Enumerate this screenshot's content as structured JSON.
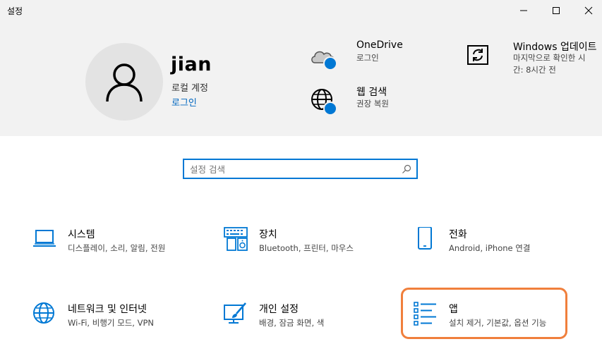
{
  "window": {
    "title": "설정"
  },
  "account": {
    "name": "jian",
    "type": "로컬 계정",
    "signin_label": "로그인"
  },
  "header_items": [
    {
      "title": "OneDrive",
      "sub": "로그인"
    },
    {
      "title": "웹 검색",
      "sub": "권장 복원"
    },
    {
      "title": "Windows 업데이트",
      "sub1": "마지막으로 확인한 시",
      "sub2": "간: 8시간 전"
    }
  ],
  "search": {
    "placeholder": "설정 검색"
  },
  "tiles": [
    {
      "title": "시스템",
      "sub": "디스플레이, 소리, 알림, 전원"
    },
    {
      "title": "장치",
      "sub": "Bluetooth, 프린터, 마우스"
    },
    {
      "title": "전화",
      "sub": "Android, iPhone 연결"
    },
    {
      "title": "네트워크 및 인터넷",
      "sub": "Wi-Fi, 비행기 모드, VPN"
    },
    {
      "title": "개인 설정",
      "sub": "배경, 잠금 화면, 색"
    },
    {
      "title": "앱",
      "sub": "설치 제거, 기본값, 옵션 기능"
    }
  ],
  "colors": {
    "accent": "#0078d4",
    "highlight": "#f07f3c",
    "header_bg": "#f2f2f2"
  }
}
